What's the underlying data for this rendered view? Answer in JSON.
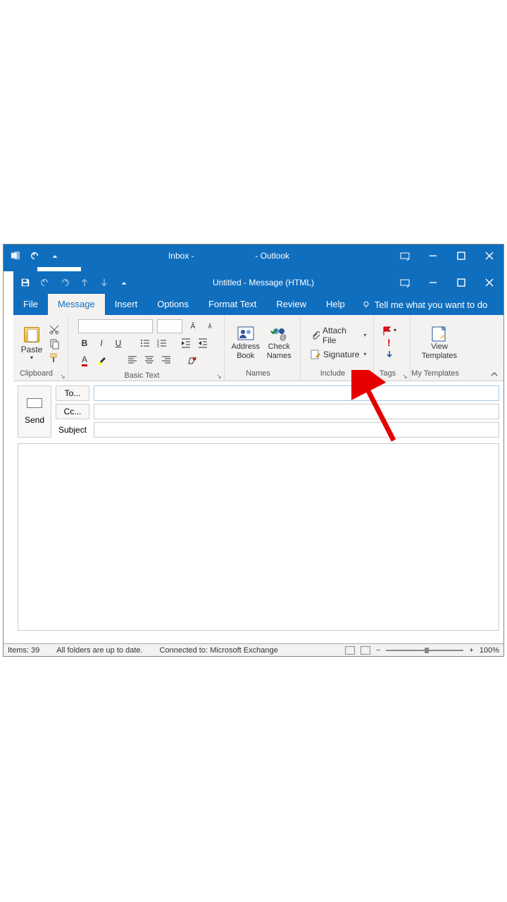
{
  "main_window": {
    "title_left": "Inbox -",
    "title_right": "- Outlook"
  },
  "compose_window": {
    "title": "Untitled  -  Message (HTML)"
  },
  "ribbon_tabs": {
    "file": "File",
    "message": "Message",
    "insert": "Insert",
    "options": "Options",
    "format_text": "Format Text",
    "review": "Review",
    "help": "Help",
    "tell_me": "Tell me what you want to do"
  },
  "ribbon": {
    "clipboard": {
      "paste": "Paste",
      "group": "Clipboard"
    },
    "basic_text": {
      "group": "Basic Text"
    },
    "names": {
      "address_book": "Address\nBook",
      "check_names": "Check\nNames",
      "group": "Names"
    },
    "include": {
      "attach_file": "Attach File",
      "signature": "Signature",
      "group": "Include"
    },
    "tags": {
      "group": "Tags"
    },
    "templates": {
      "view_templates": "View\nTemplates",
      "group": "My Templates"
    }
  },
  "address": {
    "send": "Send",
    "to": "To...",
    "cc": "Cc...",
    "subject": "Subject"
  },
  "status_bar": {
    "items": "Items: 39",
    "sync": "All folders are up to date.",
    "conn": "Connected to: Microsoft Exchange",
    "zoom": "100%"
  }
}
